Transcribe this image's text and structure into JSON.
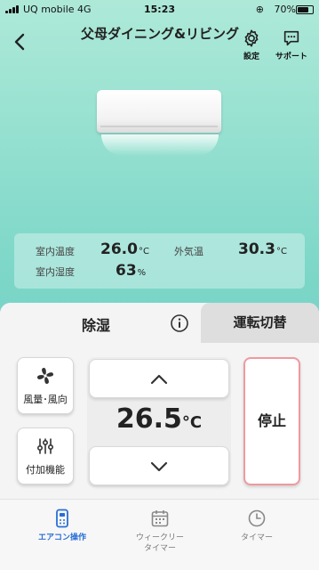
{
  "status_bar": {
    "carrier": "UQ mobile  4G",
    "time": "15:23",
    "battery": "70%"
  },
  "header": {
    "title": "父母ダイニング&リビング",
    "settings_label": "設定",
    "support_label": "サポート"
  },
  "environment": {
    "indoor_temp_label": "室内温度",
    "indoor_temp_value": "26.0",
    "indoor_temp_unit": "°C",
    "outdoor_temp_label": "外気温",
    "outdoor_temp_value": "30.3",
    "outdoor_temp_unit": "°C",
    "indoor_humidity_label": "室内湿度",
    "indoor_humidity_value": "63",
    "indoor_humidity_unit": "%"
  },
  "control": {
    "mode_label": "除湿",
    "switch_label": "運転切替",
    "fan_label": "風量･風向",
    "option_label": "付加機能",
    "set_temp_value": "26.5",
    "set_temp_unit": "°C",
    "stop_label": "停止"
  },
  "nav": {
    "ac_label": "エアコン操作",
    "weekly_label": "ウィークリー\nタイマー",
    "timer_label": "タイマー"
  },
  "colors": {
    "accent_blue": "#2a6fd6",
    "stop_border": "#ee9aa0"
  }
}
